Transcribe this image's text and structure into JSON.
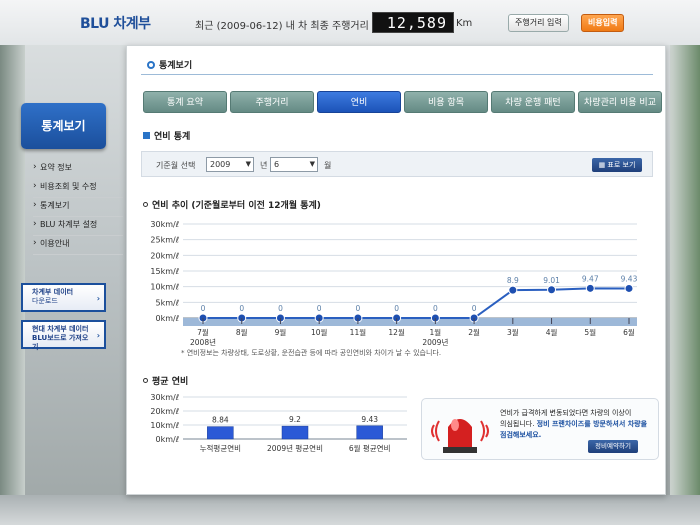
{
  "header": {
    "logo": "BLU 차계부",
    "distance_label": "최근 (2009-06-12) 내 차 최종 주행거리 :",
    "odometer": "12,589",
    "km": "Km",
    "btn_distance": "주행거리 입력",
    "btn_cost": "비용입력"
  },
  "sidebar": {
    "title": "통계보기",
    "items": [
      "요약 정보",
      "비용조회 및 수정",
      "통계보기",
      "BLU 차계부 설정",
      "이용안내"
    ],
    "box1": {
      "line1": "차계부 데이터",
      "line2": "다운로드"
    },
    "box2": {
      "line1": "현대 차계부 데이터",
      "line2": "BLU보드로 가져오기"
    }
  },
  "main": {
    "title": "통계보기",
    "tabs": [
      "통계 요약",
      "주행거리",
      "연비",
      "비용 항목",
      "차량 운행 패턴",
      "차량관리 비용 비교"
    ],
    "active_tab": 2,
    "section1": "연비 통계",
    "filter": {
      "label": "기준월 선택",
      "year": "2009",
      "year_unit": "년",
      "month": "6",
      "month_unit": "월",
      "view_btn": "표로 보기"
    },
    "chart1_title": "연비 추이 (기준월로부터 이전 12개월 통계)",
    "note": "* 연비정보는 차량상태, 도로상황, 운전습관 등에 따라 공인연비와 차이가 날 수 있습니다.",
    "chart2_title": "평균 연비",
    "alert": {
      "line1": "연비가 급격하게 변동되었다면 차량의 이상이",
      "line2": "의심됩니다.",
      "line2b": "정비 프랜차이즈를 방문하셔서 차량을",
      "line3": "점검해보세요.",
      "btn": "정비예약하기"
    }
  },
  "chart_data": [
    {
      "type": "line",
      "title": "연비 추이 (기준월로부터 이전 12개월 통계)",
      "x": [
        "7월",
        "8월",
        "9월",
        "10월",
        "11월",
        "12월",
        "1월",
        "2월",
        "3월",
        "4월",
        "5월",
        "6월"
      ],
      "year_labels": {
        "0": "2008년",
        "6": "2009년"
      },
      "values": [
        0,
        0,
        0,
        0,
        0,
        0,
        0,
        0,
        8.9,
        9.01,
        9.47,
        9.43
      ],
      "yticks": [
        "0km/ℓ",
        "5km/ℓ",
        "10km/ℓ",
        "15km/ℓ",
        "20km/ℓ",
        "25km/ℓ",
        "30km/ℓ"
      ],
      "ylim": [
        0,
        30
      ],
      "color": "#2a5fc0"
    },
    {
      "type": "bar",
      "title": "평균 연비",
      "categories": [
        "누적평균연비",
        "2009년 평균연비",
        "6월 평균연비"
      ],
      "values": [
        8.84,
        9.2,
        9.43
      ],
      "yticks": [
        "0km/ℓ",
        "10km/ℓ",
        "20km/ℓ",
        "30km/ℓ"
      ],
      "ylim": [
        0,
        30
      ],
      "color": "#2b59d6"
    }
  ]
}
